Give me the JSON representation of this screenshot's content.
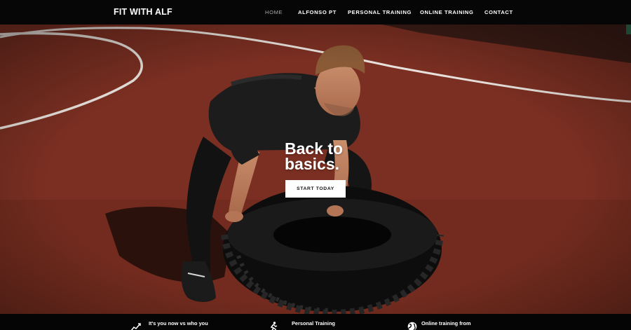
{
  "brand": "FIT WITH ALF",
  "nav": {
    "home": "HOME",
    "alfonso": "ALFONSO PT",
    "personal": "PERSONAL TRAINING",
    "online": "ONLINE TRAINING",
    "contact": "CONTACT",
    "active_color": "#a8a8a8"
  },
  "hero": {
    "headline_line1": "Back to",
    "headline_line2": "basics.",
    "cta_label": "START TODAY",
    "track_color": "#7a2f21"
  },
  "features": [
    {
      "icon": "chart-trend-icon",
      "label": "It's you now vs who you"
    },
    {
      "icon": "runner-icon",
      "label": "Personal Training"
    },
    {
      "icon": "globe-icon",
      "label": "Online training from"
    }
  ]
}
